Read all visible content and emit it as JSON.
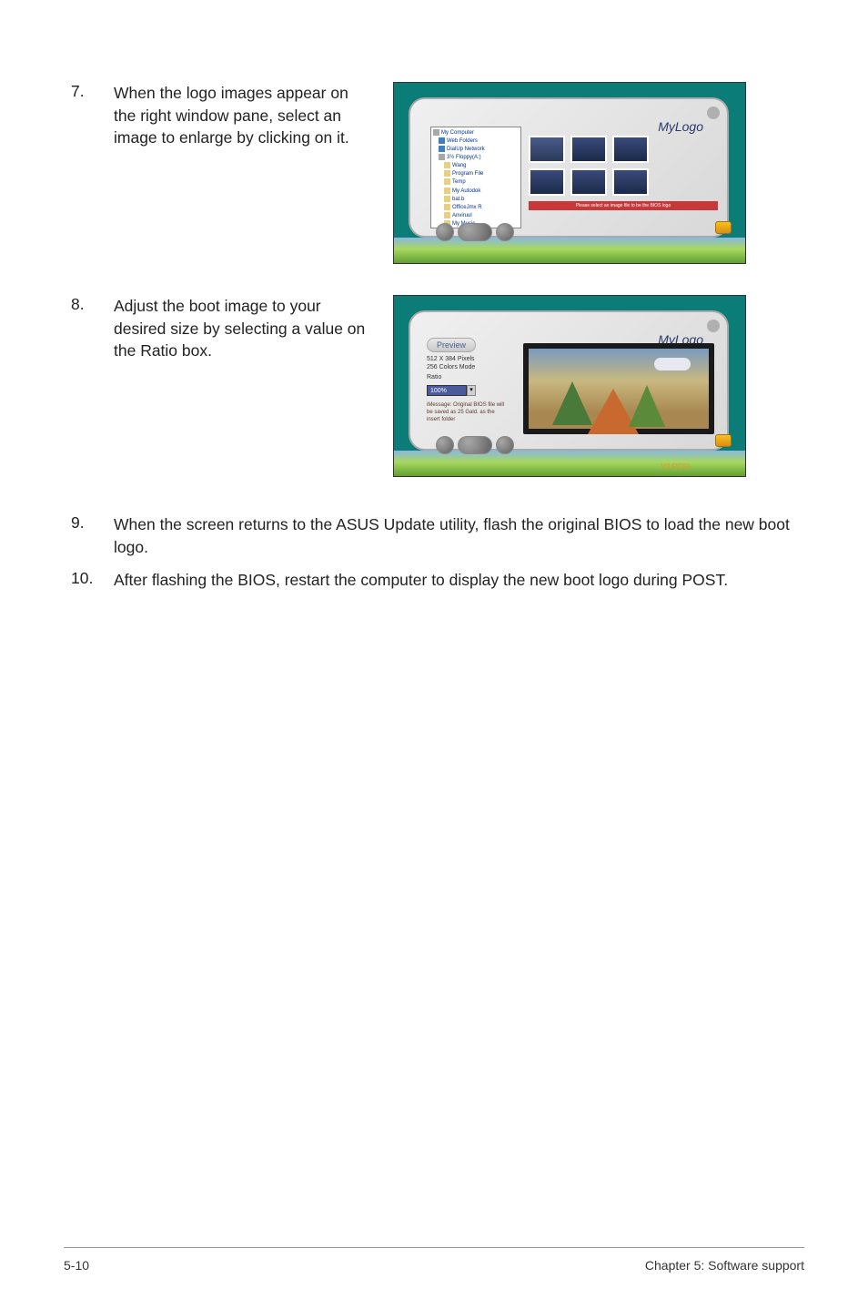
{
  "items": {
    "7": {
      "num": "7.",
      "text": "When the logo images appear on the right window pane, select an image to enlarge by clicking on it."
    },
    "8": {
      "num": "8.",
      "text": "Adjust the boot image to your desired size by selecting a value on the Ratio box."
    },
    "9": {
      "num": "9.",
      "text": "When the screen returns to the ASUS Update utility, flash the original BIOS to load the new boot logo."
    },
    "10": {
      "num": "10.",
      "text": "After flashing the BIOS, restart the computer to display the new boot logo during POST."
    }
  },
  "window1": {
    "title": "MyLogo",
    "tree": [
      "My Computer",
      "Web Folders",
      "DialUp Network",
      "3½ Floppy(A:)",
      "Wang",
      "Program File",
      "Temp",
      "My Autodok",
      "bat.b",
      "OfficeJmx R",
      "Anviruul",
      "My Music"
    ],
    "status": "Please select an image file to be the BIOS logo"
  },
  "window2": {
    "title": "MyLogo",
    "tab": "Preview",
    "info1": "512 X 384 Pixels",
    "info2": "256 Colors Mode",
    "ratio_label": "Ratio",
    "ratio_value": "100%",
    "message": "iMessage: Original BIOS file will be saved as 25 Gald. as the insert folder",
    "version": "V3.RC01"
  },
  "footer": {
    "left": "5-10",
    "right": "Chapter 5: Software support"
  }
}
